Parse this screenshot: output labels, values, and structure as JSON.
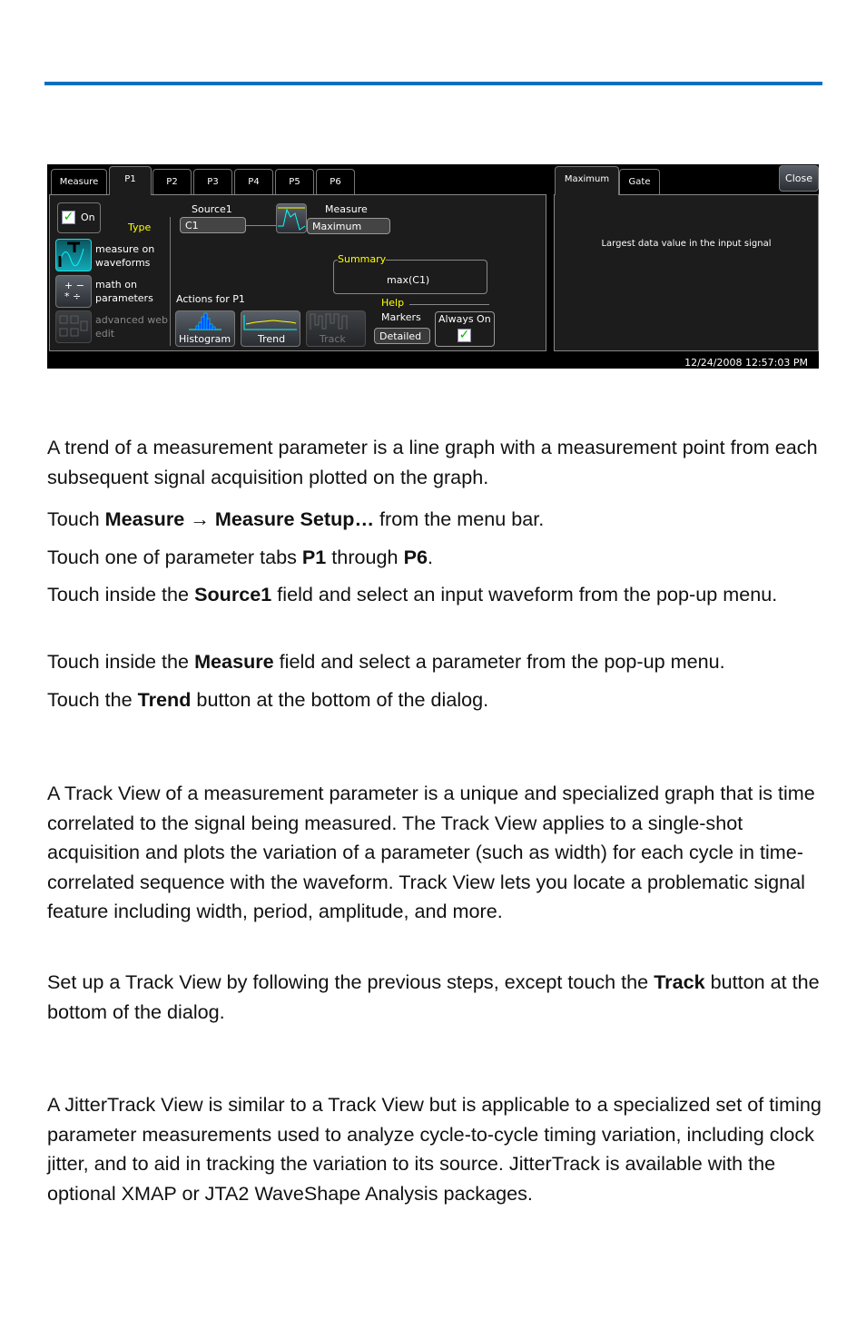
{
  "scope": {
    "tabs": [
      "Measure",
      "P1",
      "P2",
      "P3",
      "P4",
      "P5",
      "P6"
    ],
    "on_label": "On",
    "type_label": "Type",
    "type_items": [
      "measure on waveforms",
      "math on parameters",
      "advanced web edit"
    ],
    "source1_label": "Source1",
    "source1_value": "C1",
    "measure_label": "Measure",
    "measure_value": "Maximum",
    "summary_label": "Summary",
    "summary_value": "max(C1)",
    "actions_label": "Actions for P1",
    "actions": [
      "Histogram",
      "Trend",
      "Track"
    ],
    "help_label": "Help",
    "markers_label": "Markers",
    "markers_value": "Detailed",
    "always_on_label": "Always On",
    "right_tabs": [
      "Maximum",
      "Gate"
    ],
    "close_label": "Close",
    "description": "Largest data value in the input signal",
    "timestamp": "12/24/2008 12:57:03 PM"
  },
  "paragraphs": [
    [
      {
        "t": "A trend of a measurement parameter is a line graph with a measurement point from each subsequent signal acquisition plotted on the graph."
      }
    ],
    [
      {
        "t": "Touch "
      },
      {
        "t": "Measure",
        "b": true
      },
      {
        "t": " → ",
        "b": true
      },
      {
        "t": "Measure Setup…",
        "b": true
      },
      {
        "t": " from the menu bar."
      }
    ],
    [
      {
        "t": "Touch one of parameter tabs "
      },
      {
        "t": "P1",
        "b": true
      },
      {
        "t": " through "
      },
      {
        "t": "P6",
        "b": true
      },
      {
        "t": "."
      }
    ],
    [
      {
        "t": "Touch inside the "
      },
      {
        "t": "Source1",
        "b": true
      },
      {
        "t": " field and select an input waveform from the pop-up menu."
      }
    ],
    [
      {
        "t": "Touch inside the "
      },
      {
        "t": "Measure",
        "b": true
      },
      {
        "t": " field and select a parameter from the pop-up menu."
      }
    ],
    [
      {
        "t": "Touch the "
      },
      {
        "t": "Trend",
        "b": true
      },
      {
        "t": " button at the bottom of the dialog."
      }
    ],
    [
      {
        "t": "A Track View of a measurement parameter is a unique and specialized graph that is time correlated to the signal being measured. The Track View applies to a single-shot acquisition and plots the variation of a parameter (such as width) for each cycle in time-correlated sequence with the waveform. Track View lets you locate a problematic signal feature including width, period, amplitude, and more."
      }
    ],
    [
      {
        "t": "Set up a Track View by following the previous steps, except touch the "
      },
      {
        "t": "Track",
        "b": true
      },
      {
        "t": " button at the bottom of the dialog."
      }
    ],
    [
      {
        "t": "A JitterTrack View is similar to a Track View but is applicable to a specialized set of timing parameter measurements used to analyze cycle-to-cycle timing variation, including clock jitter, and to aid in tracking the variation to its source. JitterTrack is available with the optional XMAP or JTA2 WaveShape Analysis packages."
      }
    ]
  ]
}
